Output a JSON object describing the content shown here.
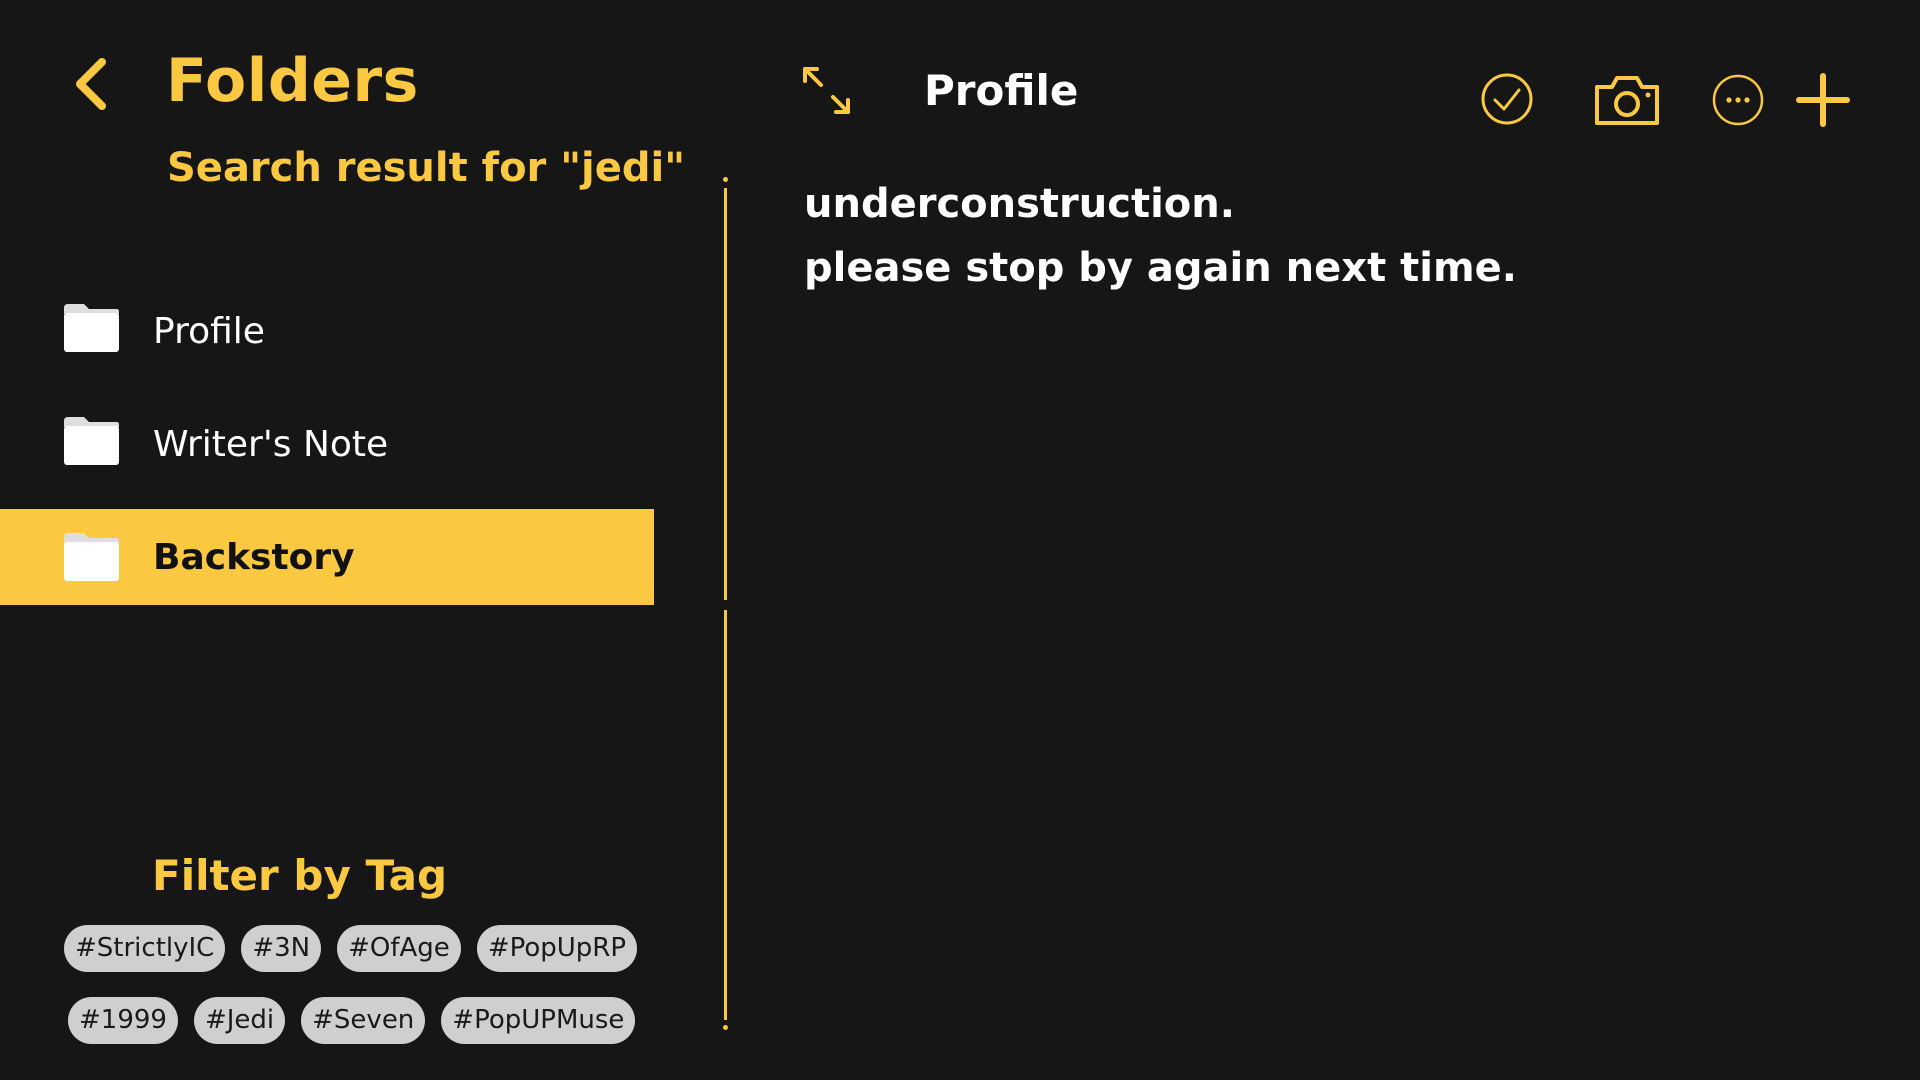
{
  "sidebar": {
    "title": "Folders",
    "search_result": "Search result for \"jedi\"",
    "folders": [
      {
        "label": "Profile",
        "active": false
      },
      {
        "label": "Writer's Note",
        "active": false
      },
      {
        "label": "Backstory",
        "active": true
      }
    ],
    "filter_title": "Filter by Tag",
    "tags_row1": [
      "#StrictlyIC",
      "#3N",
      "#OfAge",
      "#PopUpRP"
    ],
    "tags_row2": [
      "#1999",
      "#Jedi",
      "#Seven",
      "#PopUPMuse"
    ]
  },
  "note": {
    "title": "Profile",
    "lines": [
      "underconstruction.",
      "please stop by again next time."
    ]
  },
  "icons": {
    "back": "chevron-left-icon",
    "expand": "expand-arrows-icon",
    "check": "check-circle-icon",
    "camera": "camera-icon",
    "more": "more-circle-icon",
    "add": "plus-icon",
    "folder": "folder-icon"
  },
  "colors": {
    "background": "#161617",
    "accent": "#fbc842",
    "text": "#ffffff",
    "tag_bg": "#cfcfcf",
    "tag_text": "#1a1a1a"
  }
}
